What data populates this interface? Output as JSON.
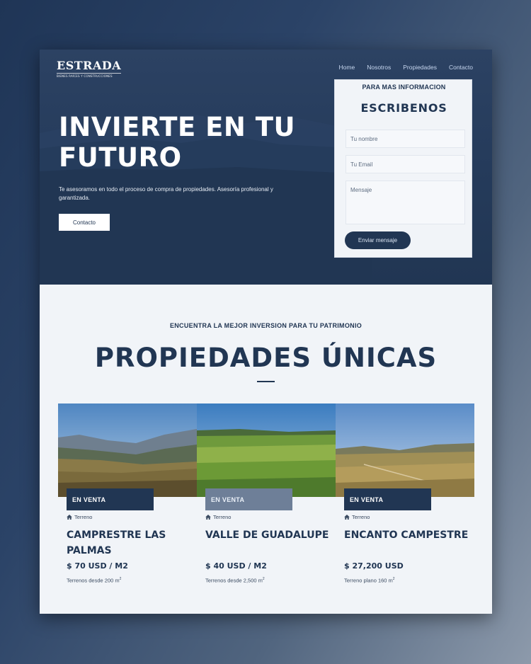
{
  "header": {
    "logo_main": "ESTRADA",
    "logo_sub": "BIENES RAÍCES Y CONSTRUCCIONES",
    "nav": [
      "Home",
      "Nosotros",
      "Propiedades",
      "Contacto"
    ]
  },
  "hero": {
    "title": "INVIERTE EN TU FUTURO",
    "subtitle": "Te asesoramos en todo el proceso de compra de propiedades. Asesoría profesional y garantizada.",
    "button_label": "Contacto"
  },
  "contact_form": {
    "kicker": "PARA MAS INFORMACION",
    "title": "ESCRIBENOS",
    "name_placeholder": "Tu nombre",
    "email_placeholder": "Tu Email",
    "message_placeholder": "Mensaje",
    "submit_label": "Enviar mensaje"
  },
  "properties_section": {
    "kicker": "ENCUENTRA LA MEJOR INVERSION PARA TU PATRIMONIO",
    "title": "PROPIEDADES ÚNICAS"
  },
  "properties": [
    {
      "badge": "EN VENTA",
      "type": "Terreno",
      "title": "CAMPRESTRE LAS PALMAS",
      "price": "$ 70 USD / M2",
      "note": "Terrenos desde 200 m",
      "note_sup": "2"
    },
    {
      "badge": "EN VENTA",
      "type": "Terreno",
      "title": "VALLE DE GUADALUPE",
      "price": "$ 40 USD / M2",
      "note": "Terrenos desde 2,500 m",
      "note_sup": "2"
    },
    {
      "badge": "EN VENTA",
      "type": "Terreno",
      "title": "ENCANTO CAMPESTRE",
      "price": "$ 27,200 USD",
      "note": "Terreno plano 160 m",
      "note_sup": "2"
    }
  ],
  "colors": {
    "brand_navy": "#213653",
    "page_bg": "#f1f4f8",
    "badge_alt": "#6e7f98"
  },
  "icons": [
    "home-icon"
  ]
}
